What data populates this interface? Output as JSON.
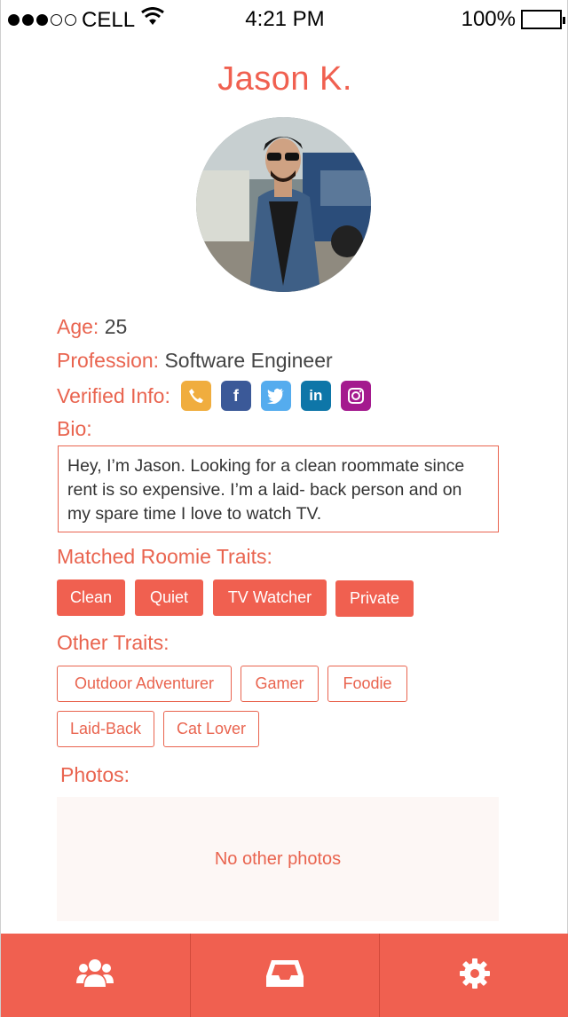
{
  "status_bar": {
    "carrier": "CELL",
    "time": "4:21 PM",
    "battery": "100%",
    "signal_bars_filled": 3,
    "signal_bars_total": 5
  },
  "profile": {
    "name": "Jason K.",
    "age_label": "Age:",
    "age_value": "25",
    "profession_label": "Profession:",
    "profession_value": "Software Engineer",
    "verified_label": "Verified Info:",
    "verified_icons": [
      {
        "name": "phone-icon",
        "color": "#f0ad3e"
      },
      {
        "name": "facebook-icon",
        "color": "#3b5998"
      },
      {
        "name": "twitter-icon",
        "color": "#55acee"
      },
      {
        "name": "linkedin-icon",
        "color": "#0e76a8"
      },
      {
        "name": "instagram-icon",
        "color": "#a41a8e"
      }
    ],
    "bio_label": "Bio:",
    "bio_text": "Hey, I’m Jason. Looking for a clean roommate since rent is so expensive. I’m a laid- back person and on my spare time I love to watch TV."
  },
  "matched": {
    "label": "Matched Roomie Traits:",
    "traits": [
      "Clean",
      "Quiet",
      "TV Watcher",
      "Private"
    ]
  },
  "other": {
    "label": "Other Traits:",
    "traits": [
      "Outdoor Adventurer",
      "Gamer",
      "Foodie",
      "Laid-Back",
      "Cat Lover"
    ]
  },
  "photos": {
    "label": "Photos:",
    "empty_text": "No other photos"
  },
  "tabbar": {
    "tabs": [
      {
        "icon": "users-icon"
      },
      {
        "icon": "inbox-icon"
      },
      {
        "icon": "gear-icon"
      }
    ]
  },
  "colors": {
    "accent": "#f06050",
    "photo_bg": "#fdf7f5"
  }
}
